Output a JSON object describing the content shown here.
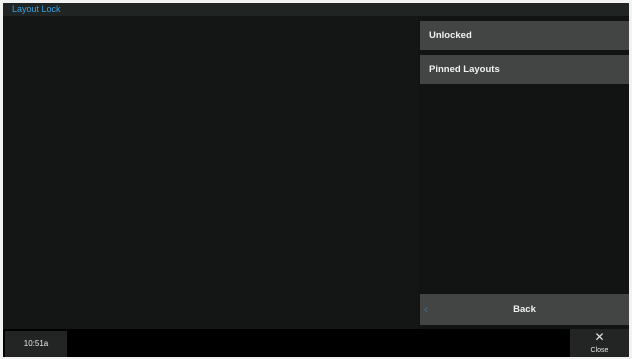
{
  "window": {
    "title": "Layout Lock"
  },
  "menu": {
    "items": [
      {
        "label": "Unlocked"
      },
      {
        "label": "Pinned Layouts"
      }
    ],
    "back_label": "Back",
    "back_icon": "chevron-left-icon"
  },
  "footer": {
    "clock": "10:51a",
    "close_label": "Close",
    "close_icon": "close-icon"
  },
  "colors": {
    "accent": "#3aa2e2",
    "button_bg": "#434545",
    "background": "#141615"
  }
}
